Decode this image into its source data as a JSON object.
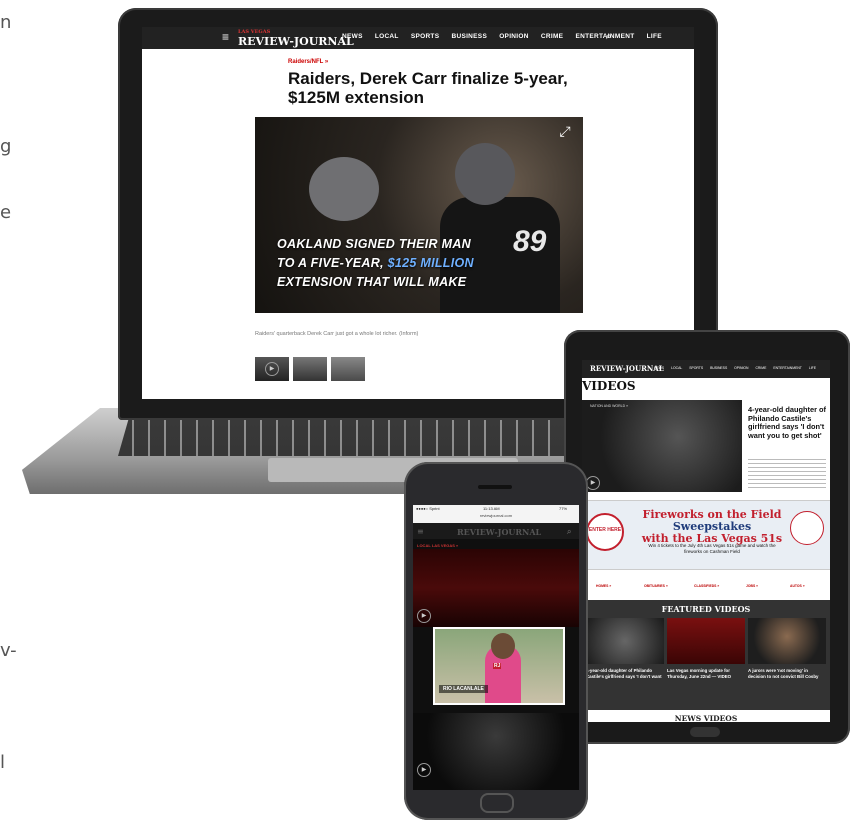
{
  "laptop": {
    "logo_small": "LAS VEGAS",
    "logo": "REVIEW-JOURNAL",
    "nav": [
      "NEWS",
      "LOCAL",
      "SPORTS",
      "BUSINESS",
      "OPINION",
      "CRIME",
      "ENTERTAINMENT",
      "LIFE"
    ],
    "breadcrumb": "Raiders/NFL »",
    "headline": "Raiders, Derek Carr finalize 5-year, $125M extension",
    "overlay_line1": "OAKLAND SIGNED THEIR MAN",
    "overlay_line2_a": "TO A FIVE-YEAR, ",
    "overlay_line2_b": "$125 MILLION",
    "overlay_line3": "EXTENSION THAT WILL MAKE",
    "jersey_number": "89",
    "caption": "Raiders' quarterback Derek Carr just got a whole lot richer. (Inform)"
  },
  "tablet": {
    "logo": "REVIEW-JOURNAL",
    "nav": [
      "NEWS",
      "LOCAL",
      "SPORTS",
      "BUSINESS",
      "OPINION",
      "CRIME",
      "ENTERTAINMENT",
      "LIFE"
    ],
    "section_title": "VIDEOS",
    "feature_tag": "NATION AND WORLD »",
    "feature_headline": "4-year-old daughter of Philando Castile's girlfriend says 'I don't want you to get shot'",
    "ad_enter": "ENTER HERE",
    "ad_title_1": "Fireworks on the Field",
    "ad_title_2": "Sweepstakes",
    "ad_title_3": "with the Las Vegas 51s",
    "ad_sub": "Win 4 tickets to the July 4th Las Vegas 51s game and watch the fireworks on Cashman Field",
    "sections": [
      "HOMES »",
      "OBITUARIES »",
      "CLASSIFIEDS »",
      "JOBS »",
      "AUTOS »"
    ],
    "featured_title": "FEATURED VIDEOS",
    "featured": [
      {
        "tag": "NATION AND WORLD »",
        "text": "4-year-old daughter of Philando Castile's girlfriend says 'I don't want"
      },
      {
        "tag": "LOCAL LAS VEGAS »",
        "text": "Las Vegas morning update for Thursday, June 22nd — VIDEO"
      },
      {
        "tag": "NATION AND WORLD »",
        "text": "A jurors were 'not moving' in decision to not convict Bill Cosby"
      }
    ],
    "news_videos_title": "NEWS VIDEOS"
  },
  "phone": {
    "carrier": "●●●●○ Sprint",
    "time": "11:13 AM",
    "battery": "77%",
    "url": "reviewjournal.com",
    "logo": "REVIEW-JOURNAL",
    "local_label": "LOCAL LAS VEGAS »",
    "reporter_name": "RIO LACANLALE",
    "badge": "RJ"
  },
  "icons": {
    "search": "⌕",
    "menu": "≡",
    "play": "▶",
    "expand": "⤢"
  },
  "colors": {
    "brand_red": "#c21f2d",
    "nav_dark": "#222222",
    "highlight_blue": "#6fb0ff"
  }
}
